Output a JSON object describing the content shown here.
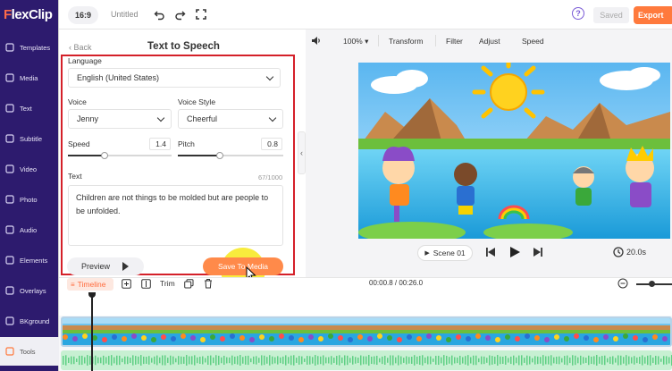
{
  "app": {
    "logo": "FlexClip"
  },
  "sidebar": {
    "items": [
      {
        "label": "Templates",
        "icon": "templates-icon"
      },
      {
        "label": "Media",
        "icon": "media-icon"
      },
      {
        "label": "Text",
        "icon": "text-icon"
      },
      {
        "label": "Subtitle",
        "icon": "subtitle-icon"
      },
      {
        "label": "Video",
        "icon": "video-icon"
      },
      {
        "label": "Photo",
        "icon": "photo-icon"
      },
      {
        "label": "Audio",
        "icon": "audio-icon"
      },
      {
        "label": "Elements",
        "icon": "elements-icon"
      },
      {
        "label": "Overlays",
        "icon": "overlays-icon"
      },
      {
        "label": "BKground",
        "icon": "background-icon"
      },
      {
        "label": "Tools",
        "icon": "tools-icon",
        "active": true
      }
    ]
  },
  "topbar": {
    "aspect_ratio": "16:9",
    "project_title": "Untitled",
    "help": "?",
    "saved_label": "Saved",
    "export_label": "Export"
  },
  "panel": {
    "back_label": "Back",
    "title": "Text to Speech",
    "language_label": "Language",
    "language_value": "English (United States)",
    "voice_label": "Voice",
    "voice_value": "Jenny",
    "voice_style_label": "Voice Style",
    "voice_style_value": "Cheerful",
    "speed_label": "Speed",
    "speed_value": "1.4",
    "speed_fraction": 0.35,
    "pitch_label": "Pitch",
    "pitch_value": "0.8",
    "pitch_fraction": 0.4,
    "text_label": "Text",
    "char_count": "67/1000",
    "text_value": "Children are not things to be molded but are people to be unfolded.",
    "preview_label": "Preview",
    "save_label": "Save To Media"
  },
  "preview": {
    "zoom": "100%",
    "tools": [
      "Transform",
      "Filter",
      "Adjust",
      "Speed"
    ],
    "scene_label": "Scene 01",
    "duration": "20.0s"
  },
  "timeline": {
    "tab_label": "Timeline",
    "trim_label": "Trim",
    "time_code": "00:00.8 / 00:26.0"
  },
  "colors": {
    "sidebar_bg": "#2d1b6e",
    "accent": "#ff7a3d",
    "highlight": "#d42029",
    "cursor_glow": "#f7ea28"
  }
}
